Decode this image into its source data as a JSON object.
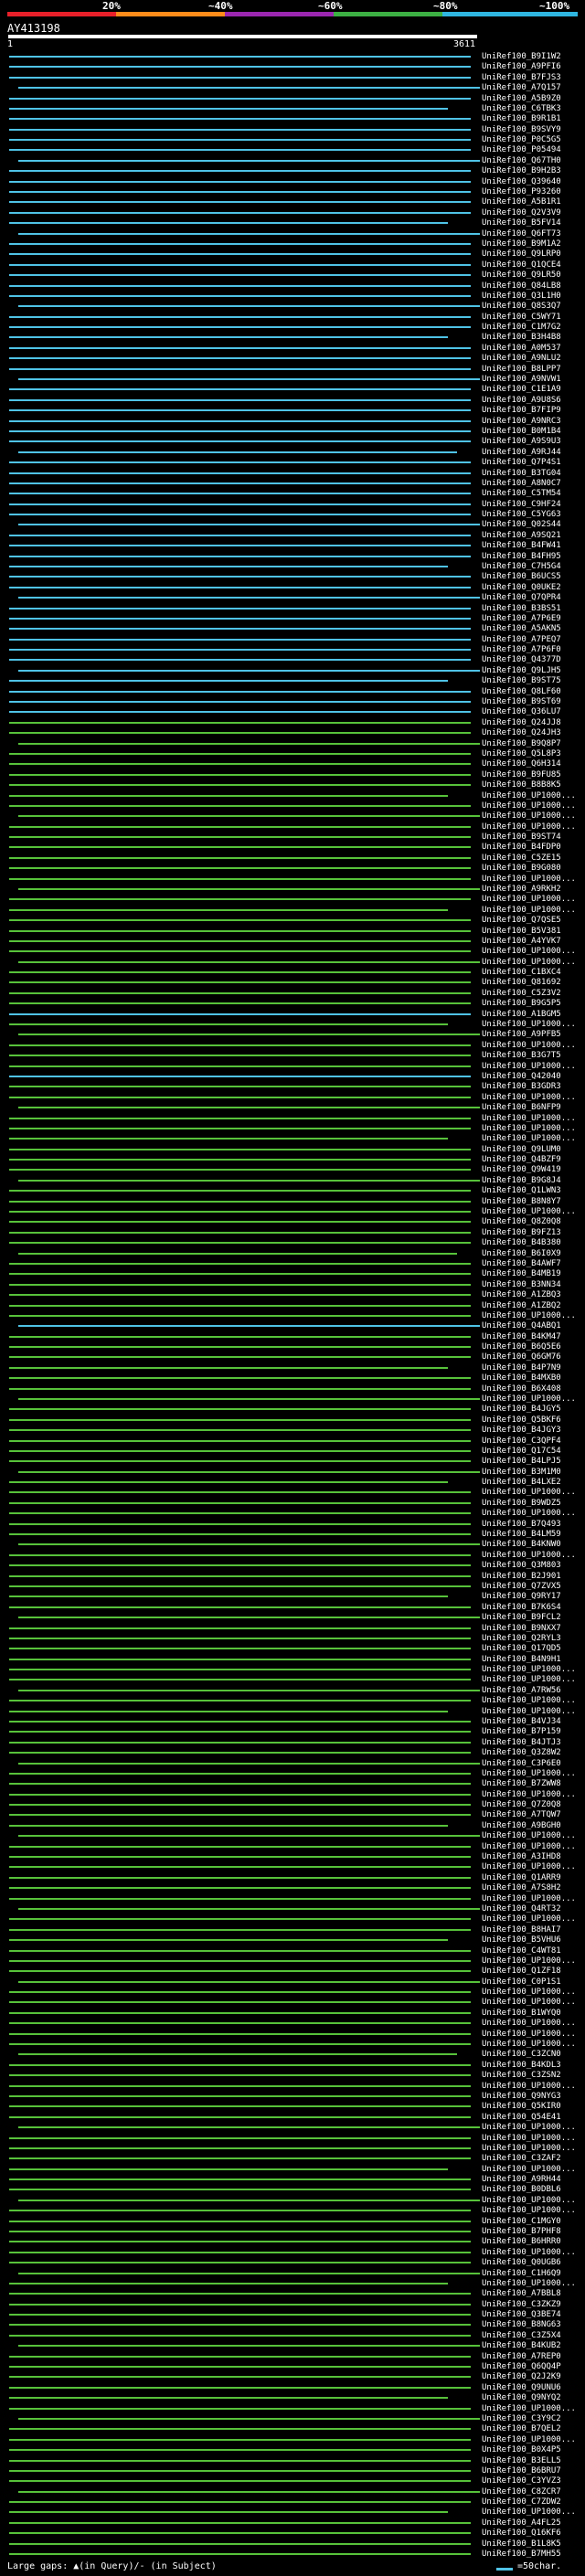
{
  "scale": {
    "labels": [
      "20%",
      "~40%",
      "~60%",
      "~80%",
      "~100%"
    ],
    "colors": [
      "#e8202a",
      "#ff8c1a",
      "#9b27b0",
      "#3cb043",
      "#2fb6e0"
    ]
  },
  "query": {
    "accession": "AY413198",
    "start": "1",
    "end": "3611"
  },
  "colors": {
    "blue": "#4fc3e6",
    "green": "#57c23a",
    "gap": "#444444"
  },
  "hits": [
    {
      "label": "UniRef100_B9I1W2",
      "color": "blue"
    },
    {
      "label": "UniRef100_A9PFI6",
      "color": "blue"
    },
    {
      "label": "UniRef100_B7FJS3",
      "color": "blue"
    },
    {
      "label": "UniRef100_A7Q157",
      "color": "blue"
    },
    {
      "label": "UniRef100_A5B9Z0",
      "color": "blue"
    },
    {
      "label": "UniRef100_C6TBK3",
      "color": "blue"
    },
    {
      "label": "UniRef100_B9R1B1",
      "color": "blue"
    },
    {
      "label": "UniRef100_B9SVY9",
      "color": "blue"
    },
    {
      "label": "UniRef100_P0C5G5",
      "color": "blue"
    },
    {
      "label": "UniRef100_P05494",
      "color": "blue"
    },
    {
      "label": "UniRef100_Q67TH0",
      "color": "blue"
    },
    {
      "label": "UniRef100_B9H2B3",
      "color": "blue"
    },
    {
      "label": "UniRef100_Q39640",
      "color": "blue"
    },
    {
      "label": "UniRef100_P93260",
      "color": "blue"
    },
    {
      "label": "UniRef100_A5B1R1",
      "color": "blue"
    },
    {
      "label": "UniRef100_Q2V3V9",
      "color": "blue"
    },
    {
      "label": "UniRef100_B5FV14",
      "color": "blue"
    },
    {
      "label": "UniRef100_Q6FT73",
      "color": "blue"
    },
    {
      "label": "UniRef100_B9M1A2",
      "color": "blue"
    },
    {
      "label": "UniRef100_Q9LRP0",
      "color": "blue"
    },
    {
      "label": "UniRef100_Q1QCE4",
      "color": "blue"
    },
    {
      "label": "UniRef100_Q9LR50",
      "color": "blue"
    },
    {
      "label": "UniRef100_Q84LB8",
      "color": "blue"
    },
    {
      "label": "UniRef100_Q3L1H0",
      "color": "blue"
    },
    {
      "label": "UniRef100_Q8S3Q7",
      "color": "blue"
    },
    {
      "label": "UniRef100_C5WY71",
      "color": "blue"
    },
    {
      "label": "UniRef100_C1M7G2",
      "color": "blue"
    },
    {
      "label": "UniRef100_B3H4B8",
      "color": "blue"
    },
    {
      "label": "UniRef100_A0M537",
      "color": "blue"
    },
    {
      "label": "UniRef100_A9NLU2",
      "color": "blue"
    },
    {
      "label": "UniRef100_B8LPP7",
      "color": "blue"
    },
    {
      "label": "UniRef100_A9NVW1",
      "color": "blue"
    },
    {
      "label": "UniRef100_C1E1A9",
      "color": "blue"
    },
    {
      "label": "UniRef100_A9U8S6",
      "color": "blue"
    },
    {
      "label": "UniRef100_B7FIP9",
      "color": "blue"
    },
    {
      "label": "UniRef100_A9NRC3",
      "color": "blue"
    },
    {
      "label": "UniRef100_B0M1B4",
      "color": "blue"
    },
    {
      "label": "UniRef100_A9S9U3",
      "color": "blue"
    },
    {
      "label": "UniRef100_A9RJ44",
      "color": "blue"
    },
    {
      "label": "UniRef100_Q7P4S1",
      "color": "blue"
    },
    {
      "label": "UniRef100_B3TG04",
      "color": "blue"
    },
    {
      "label": "UniRef100_A8N0C7",
      "color": "blue"
    },
    {
      "label": "UniRef100_C5TM54",
      "color": "blue"
    },
    {
      "label": "UniRef100_C9HF24",
      "color": "blue"
    },
    {
      "label": "UniRef100_C5YG63",
      "color": "blue"
    },
    {
      "label": "UniRef100_Q02S44",
      "color": "blue"
    },
    {
      "label": "UniRef100_A9SQ21",
      "color": "blue"
    },
    {
      "label": "UniRef100_B4FW41",
      "color": "blue"
    },
    {
      "label": "UniRef100_B4FH95",
      "color": "blue"
    },
    {
      "label": "UniRef100_C7H5G4",
      "color": "blue"
    },
    {
      "label": "UniRef100_B6UCS5",
      "color": "blue"
    },
    {
      "label": "UniRef100_Q0UKE2",
      "color": "blue"
    },
    {
      "label": "UniRef100_Q7QPR4",
      "color": "blue"
    },
    {
      "label": "UniRef100_B3BS51",
      "color": "blue"
    },
    {
      "label": "UniRef100_A7P6E9",
      "color": "blue"
    },
    {
      "label": "UniRef100_A5AKN5",
      "color": "blue"
    },
    {
      "label": "UniRef100_A7PEQ7",
      "color": "blue"
    },
    {
      "label": "UniRef100_A7P6F0",
      "color": "blue"
    },
    {
      "label": "UniRef100_Q4377D",
      "color": "blue"
    },
    {
      "label": "UniRef100_Q9LJH5",
      "color": "blue"
    },
    {
      "label": "UniRef100_B9ST75",
      "color": "blue"
    },
    {
      "label": "UniRef100_Q8LF60",
      "color": "blue"
    },
    {
      "label": "UniRef100_B9ST69",
      "color": "blue"
    },
    {
      "label": "UniRef100_Q36LU7",
      "color": "blue"
    },
    {
      "label": "UniRef100_Q24JJ8",
      "color": "green"
    },
    {
      "label": "UniRef100_Q24JH3",
      "color": "green"
    },
    {
      "label": "UniRef100_B9Q8P7",
      "color": "green"
    },
    {
      "label": "UniRef100_Q5L8P3",
      "color": "green"
    },
    {
      "label": "UniRef100_Q6H314",
      "color": "green"
    },
    {
      "label": "UniRef100_B9FU85",
      "color": "green"
    },
    {
      "label": "UniRef100_B8B8K5",
      "color": "green"
    },
    {
      "label": "UniRef100_UP1000...",
      "color": "green"
    },
    {
      "label": "UniRef100_UP1000...",
      "color": "green"
    },
    {
      "label": "UniRef100_UP1000...",
      "color": "green"
    },
    {
      "label": "UniRef100_UP1000...",
      "color": "green"
    },
    {
      "label": "UniRef100_B9ST74",
      "color": "green"
    },
    {
      "label": "UniRef100_B4FDP0",
      "color": "green"
    },
    {
      "label": "UniRef100_C5ZE15",
      "color": "green"
    },
    {
      "label": "UniRef100_B9G080",
      "color": "green"
    },
    {
      "label": "UniRef100_UP1000...",
      "color": "green"
    },
    {
      "label": "UniRef100_A9RKH2",
      "color": "green"
    },
    {
      "label": "UniRef100_UP1000...",
      "color": "green"
    },
    {
      "label": "UniRef100_UP1000...",
      "color": "green"
    },
    {
      "label": "UniRef100_Q7QSE5",
      "color": "green"
    },
    {
      "label": "UniRef100_B5V381",
      "color": "green"
    },
    {
      "label": "UniRef100_A4YVK7",
      "color": "green"
    },
    {
      "label": "UniRef100_UP1000...",
      "color": "green"
    },
    {
      "label": "UniRef100_UP1000...",
      "color": "green"
    },
    {
      "label": "UniRef100_C1BXC4",
      "color": "green"
    },
    {
      "label": "UniRef100_Q81692",
      "color": "green"
    },
    {
      "label": "UniRef100_C5Z3V2",
      "color": "green"
    },
    {
      "label": "UniRef100_B9G5P5",
      "color": "green"
    },
    {
      "label": "UniRef100_A1BGM5",
      "color": "blue"
    },
    {
      "label": "UniRef100_UP1000...",
      "color": "green"
    },
    {
      "label": "UniRef100_A9PFB5",
      "color": "green"
    },
    {
      "label": "UniRef100_UP1000...",
      "color": "green"
    },
    {
      "label": "UniRef100_B3G7T5",
      "color": "green"
    },
    {
      "label": "UniRef100_UP1000...",
      "color": "green"
    },
    {
      "label": "UniRef100_Q42040",
      "color": "blue"
    },
    {
      "label": "UniRef100_B3GDR3",
      "color": "green"
    },
    {
      "label": "UniRef100_UP1000...",
      "color": "green"
    },
    {
      "label": "UniRef100_B6NFP9",
      "color": "green"
    },
    {
      "label": "UniRef100_UP1000...",
      "color": "green"
    },
    {
      "label": "UniRef100_UP1000...",
      "color": "green"
    },
    {
      "label": "UniRef100_UP1000...",
      "color": "green"
    },
    {
      "label": "UniRef100_Q9LUM0",
      "color": "green"
    },
    {
      "label": "UniRef100_Q4BZF9",
      "color": "green"
    },
    {
      "label": "UniRef100_Q9W419",
      "color": "green"
    },
    {
      "label": "UniRef100_B9G8J4",
      "color": "green"
    },
    {
      "label": "UniRef100_Q1LWN3",
      "color": "green"
    },
    {
      "label": "UniRef100_B8N8Y7",
      "color": "green"
    },
    {
      "label": "UniRef100_UP1000...",
      "color": "green"
    },
    {
      "label": "UniRef100_Q8Z0Q8",
      "color": "green"
    },
    {
      "label": "UniRef100_B9FZ13",
      "color": "green"
    },
    {
      "label": "UniRef100_B4B380",
      "color": "green"
    },
    {
      "label": "UniRef100_B6I0X9",
      "color": "green"
    },
    {
      "label": "UniRef100_B4AWF7",
      "color": "green"
    },
    {
      "label": "UniRef100_B4MB19",
      "color": "green"
    },
    {
      "label": "UniRef100_B3NN34",
      "color": "green"
    },
    {
      "label": "UniRef100_A1ZBQ3",
      "color": "green"
    },
    {
      "label": "UniRef100_A1ZBQ2",
      "color": "green"
    },
    {
      "label": "UniRef100_UP1000...",
      "color": "green"
    },
    {
      "label": "UniRef100_Q4ABQ1",
      "color": "blue"
    },
    {
      "label": "UniRef100_B4KM47",
      "color": "green"
    },
    {
      "label": "UniRef100_B6Q5E6",
      "color": "green"
    },
    {
      "label": "UniRef100_Q6GM76",
      "color": "green"
    },
    {
      "label": "UniRef100_B4P7N9",
      "color": "green"
    },
    {
      "label": "UniRef100_B4MXB0",
      "color": "green"
    },
    {
      "label": "UniRef100_B6X408",
      "color": "green"
    },
    {
      "label": "UniRef100_UP1000...",
      "color": "green"
    },
    {
      "label": "UniRef100_B4JGY5",
      "color": "green"
    },
    {
      "label": "UniRef100_Q5BKF6",
      "color": "green"
    },
    {
      "label": "UniRef100_B4JGY3",
      "color": "green"
    },
    {
      "label": "UniRef100_C3QPF4",
      "color": "green"
    },
    {
      "label": "UniRef100_Q17C54",
      "color": "green"
    },
    {
      "label": "UniRef100_B4LPJ5",
      "color": "green"
    },
    {
      "label": "UniRef100_B3M1M0",
      "color": "green"
    },
    {
      "label": "UniRef100_B4LXE2",
      "color": "green"
    },
    {
      "label": "UniRef100_UP1000...",
      "color": "green"
    },
    {
      "label": "UniRef100_B9WDZ5",
      "color": "green"
    },
    {
      "label": "UniRef100_UP1000...",
      "color": "green"
    },
    {
      "label": "UniRef100_B7Q493",
      "color": "green"
    },
    {
      "label": "UniRef100_B4LM59",
      "color": "green"
    },
    {
      "label": "UniRef100_B4KNW0",
      "color": "green"
    },
    {
      "label": "UniRef100_UP1000...",
      "color": "green"
    },
    {
      "label": "UniRef100_Q3M803",
      "color": "green"
    },
    {
      "label": "UniRef100_B2J901",
      "color": "green"
    },
    {
      "label": "UniRef100_Q7ZVX5",
      "color": "green"
    },
    {
      "label": "UniRef100_Q9RY17",
      "color": "green"
    },
    {
      "label": "UniRef100_B7K6S4",
      "color": "green"
    },
    {
      "label": "UniRef100_B9FCL2",
      "color": "green"
    },
    {
      "label": "UniRef100_B9NXX7",
      "color": "green"
    },
    {
      "label": "UniRef100_Q2RYL3",
      "color": "green"
    },
    {
      "label": "UniRef100_Q17QD5",
      "color": "green"
    },
    {
      "label": "UniRef100_B4N9H1",
      "color": "green"
    },
    {
      "label": "UniRef100_UP1000...",
      "color": "green"
    },
    {
      "label": "UniRef100_UP1000...",
      "color": "green"
    },
    {
      "label": "UniRef100_A7RW56",
      "color": "green"
    },
    {
      "label": "UniRef100_UP1000...",
      "color": "green"
    },
    {
      "label": "UniRef100_UP1000...",
      "color": "green"
    },
    {
      "label": "UniRef100_B4VJ34",
      "color": "green"
    },
    {
      "label": "UniRef100_B7P159",
      "color": "green"
    },
    {
      "label": "UniRef100_B4JTJ3",
      "color": "green"
    },
    {
      "label": "UniRef100_Q3Z8W2",
      "color": "green"
    },
    {
      "label": "UniRef100_C3P6E0",
      "color": "green"
    },
    {
      "label": "UniRef100_UP1000...",
      "color": "green"
    },
    {
      "label": "UniRef100_B7ZWW8",
      "color": "green"
    },
    {
      "label": "UniRef100_UP1000...",
      "color": "green"
    },
    {
      "label": "UniRef100_Q7Z0Q8",
      "color": "green"
    },
    {
      "label": "UniRef100_A7TQW7",
      "color": "green"
    },
    {
      "label": "UniRef100_A9BGH0",
      "color": "green"
    },
    {
      "label": "UniRef100_UP1000...",
      "color": "green"
    },
    {
      "label": "UniRef100_UP1000...",
      "color": "green"
    },
    {
      "label": "UniRef100_A3IHD8",
      "color": "green"
    },
    {
      "label": "UniRef100_UP1000...",
      "color": "green"
    },
    {
      "label": "UniRef100_Q1ARR9",
      "color": "green"
    },
    {
      "label": "UniRef100_A7S8H2",
      "color": "green"
    },
    {
      "label": "UniRef100_UP1000...",
      "color": "green"
    },
    {
      "label": "UniRef100_Q4RT32",
      "color": "green"
    },
    {
      "label": "UniRef100_UP1000...",
      "color": "green"
    },
    {
      "label": "UniRef100_B8HAI7",
      "color": "green"
    },
    {
      "label": "UniRef100_B5VHU6",
      "color": "green"
    },
    {
      "label": "UniRef100_C4WT81",
      "color": "green"
    },
    {
      "label": "UniRef100_UP1000...",
      "color": "green"
    },
    {
      "label": "UniRef100_Q1ZF18",
      "color": "green"
    },
    {
      "label": "UniRef100_C0P1S1",
      "color": "green"
    },
    {
      "label": "UniRef100_UP1000...",
      "color": "green"
    },
    {
      "label": "UniRef100_UP1000...",
      "color": "green"
    },
    {
      "label": "UniRef100_B1WYQ0",
      "color": "green"
    },
    {
      "label": "UniRef100_UP1000...",
      "color": "green"
    },
    {
      "label": "UniRef100_UP1000...",
      "color": "green"
    },
    {
      "label": "UniRef100_UP1000...",
      "color": "green"
    },
    {
      "label": "UniRef100_C3ZCN0",
      "color": "green"
    },
    {
      "label": "UniRef100_B4KDL3",
      "color": "green"
    },
    {
      "label": "UniRef100_C3ZSN2",
      "color": "green"
    },
    {
      "label": "UniRef100_UP1000...",
      "color": "green"
    },
    {
      "label": "UniRef100_Q9NYG3",
      "color": "green"
    },
    {
      "label": "UniRef100_Q5KIR0",
      "color": "green"
    },
    {
      "label": "UniRef100_Q54E41",
      "color": "green"
    },
    {
      "label": "UniRef100_UP1000...",
      "color": "green"
    },
    {
      "label": "UniRef100_UP1000...",
      "color": "green"
    },
    {
      "label": "UniRef100_UP1000...",
      "color": "green"
    },
    {
      "label": "UniRef100_C3ZAF2",
      "color": "green"
    },
    {
      "label": "UniRef100_UP1000...",
      "color": "green"
    },
    {
      "label": "UniRef100_A9RH44",
      "color": "green"
    },
    {
      "label": "UniRef100_B0DBL6",
      "color": "green"
    },
    {
      "label": "UniRef100_UP1000...",
      "color": "green"
    },
    {
      "label": "UniRef100_UP1000...",
      "color": "green"
    },
    {
      "label": "UniRef100_C1MGY0",
      "color": "green"
    },
    {
      "label": "UniRef100_B7PHF8",
      "color": "green"
    },
    {
      "label": "UniRef100_B6HRR0",
      "color": "green"
    },
    {
      "label": "UniRef100_UP1000...",
      "color": "green"
    },
    {
      "label": "UniRef100_Q0UGB6",
      "color": "green"
    },
    {
      "label": "UniRef100_C1H6Q9",
      "color": "green"
    },
    {
      "label": "UniRef100_UP1000...",
      "color": "green"
    },
    {
      "label": "UniRef100_A7BBL8",
      "color": "green"
    },
    {
      "label": "UniRef100_C3ZKZ9",
      "color": "green"
    },
    {
      "label": "UniRef100_Q3BE74",
      "color": "green"
    },
    {
      "label": "UniRef100_B8NG63",
      "color": "green"
    },
    {
      "label": "UniRef100_C3Z5X4",
      "color": "green"
    },
    {
      "label": "UniRef100_B4KUB2",
      "color": "green"
    },
    {
      "label": "UniRef100_A7REP0",
      "color": "green"
    },
    {
      "label": "UniRef100_Q6QQ4P",
      "color": "green"
    },
    {
      "label": "UniRef100_Q2J2K9",
      "color": "green"
    },
    {
      "label": "UniRef100_Q9UNU6",
      "color": "green"
    },
    {
      "label": "UniRef100_Q9NYQ2",
      "color": "green"
    },
    {
      "label": "UniRef100_UP1000...",
      "color": "green"
    },
    {
      "label": "UniRef100_C3Y9C2",
      "color": "green"
    },
    {
      "label": "UniRef100_B7QEL2",
      "color": "green"
    },
    {
      "label": "UniRef100_UP1000...",
      "color": "green"
    },
    {
      "label": "UniRef100_B0X4P5",
      "color": "green"
    },
    {
      "label": "UniRef100_B3ELL5",
      "color": "green"
    },
    {
      "label": "UniRef100_B6BRU7",
      "color": "green"
    },
    {
      "label": "UniRef100_C3YVZ3",
      "color": "green"
    },
    {
      "label": "UniRef100_C8ZCR7",
      "color": "green"
    },
    {
      "label": "UniRef100_C7ZDW2",
      "color": "green"
    },
    {
      "label": "UniRef100_UP1000...",
      "color": "green"
    },
    {
      "label": "UniRef100_A4FL25",
      "color": "green"
    },
    {
      "label": "UniRef100_Q16KF6",
      "color": "green"
    },
    {
      "label": "UniRef100_B1L8K5",
      "color": "green"
    },
    {
      "label": "UniRef100_B7MH55",
      "color": "green"
    }
  ],
  "footer": {
    "large_gaps": "Large gaps: ▲(in Query)/- (in Subject)",
    "legend": "=50char."
  }
}
